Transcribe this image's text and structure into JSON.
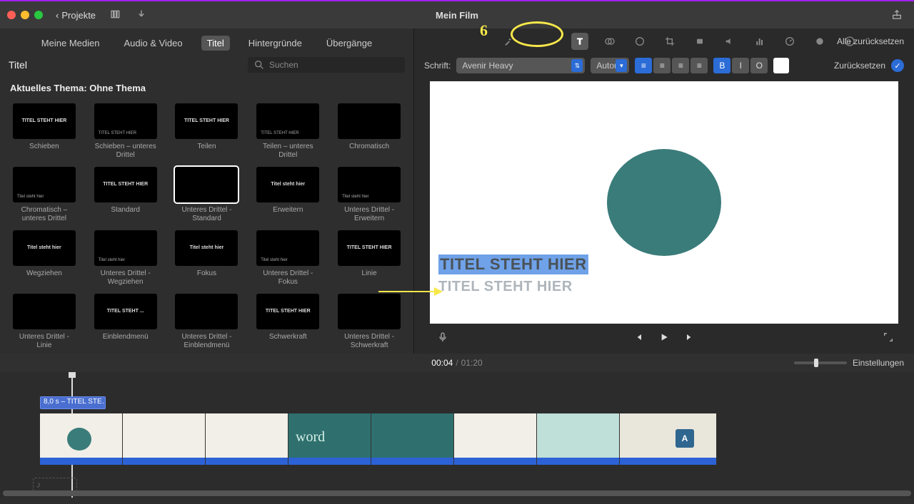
{
  "app_title": "Mein Film",
  "back_label": "Projekte",
  "media_tabs": {
    "meine_medien": "Meine Medien",
    "audio_video": "Audio & Video",
    "titel": "Titel",
    "hintergruende": "Hintergründe",
    "uebergaenge": "Übergänge"
  },
  "panel_heading": "Titel",
  "search_placeholder": "Suchen",
  "theme_line": "Aktuelles Thema: Ohne Thema",
  "titles": [
    {
      "label": "Schieben",
      "preview": "TITEL STEHT HIER"
    },
    {
      "label": "Schieben – unteres Drittel",
      "preview": "TITEL STEHT HIER",
      "lower": true
    },
    {
      "label": "Teilen",
      "preview": "TITEL STEHT HIER"
    },
    {
      "label": "Teilen – unteres Drittel",
      "preview": "TITEL STEHT HIER",
      "lower": true
    },
    {
      "label": "Chromatisch",
      "preview": ""
    },
    {
      "label": "Chromatisch – unteres Drittel",
      "preview": "Titel steht hier",
      "lower": true
    },
    {
      "label": "Standard",
      "preview": "TITEL STEHT HIER"
    },
    {
      "label": "Unteres Drittel - Standard",
      "preview": "",
      "lower": true,
      "selected": true
    },
    {
      "label": "Erweitern",
      "preview": "Titel steht hier"
    },
    {
      "label": "Unteres Drittel - Erweitern",
      "preview": "Titel steht hier",
      "lower": true
    },
    {
      "label": "Wegziehen",
      "preview": "Titel steht hier"
    },
    {
      "label": "Unteres Drittel - Wegziehen",
      "preview": "Titel steht hier",
      "lower": true
    },
    {
      "label": "Fokus",
      "preview": "Titel steht hier"
    },
    {
      "label": "Unteres Drittel - Fokus",
      "preview": "Titel steht hier",
      "lower": true
    },
    {
      "label": "Linie",
      "preview": "TITEL STEHT HIER"
    },
    {
      "label": "Unteres Drittel - Linie",
      "preview": "",
      "lower": true
    },
    {
      "label": "Einblendmenü",
      "preview": "TITEL STEHT ..."
    },
    {
      "label": "Unteres Drittel - Einblendmenü",
      "preview": "",
      "lower": true
    },
    {
      "label": "Schwerkraft",
      "preview": "TITEL STEHT HIER"
    },
    {
      "label": "Unteres Drittel - Schwerkraft",
      "preview": "",
      "lower": true
    }
  ],
  "adjust": {
    "reset_all": "Alle zurücksetzen"
  },
  "font_row": {
    "label": "Schrift:",
    "family": "Avenir Heavy",
    "size": "Auton",
    "bold": "B",
    "italic": "I",
    "outline": "O",
    "reset": "Zurücksetzen"
  },
  "viewer_text": {
    "line1": "TITEL STEHT HIER",
    "line2": "TITEL STEHT HIER"
  },
  "time": {
    "current": "00:04",
    "duration": "01:20",
    "settings": "Einstellungen"
  },
  "timeline": {
    "title_chip": "8,0 s – TITEL STE…"
  },
  "annotation": {
    "num": "6"
  }
}
